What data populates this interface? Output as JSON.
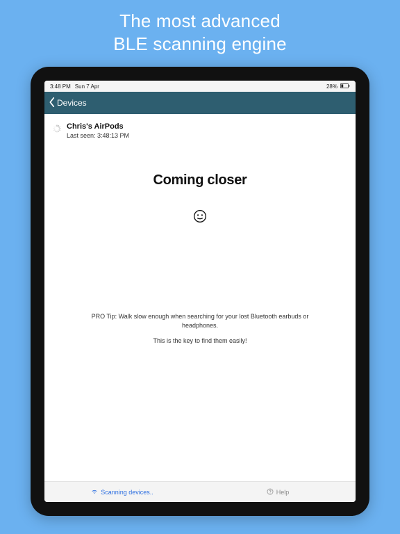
{
  "promo": {
    "line1": "The most advanced",
    "line2": "BLE scanning engine"
  },
  "status_bar": {
    "time": "3:48 PM",
    "date": "Sun 7 Apr",
    "battery": "28%"
  },
  "nav": {
    "back_label": "Devices"
  },
  "device": {
    "name": "Chris's AirPods",
    "last_seen_label": "Last seen: 3:48:13 PM"
  },
  "status_heading": "Coming closer",
  "tip": {
    "line1": "PRO Tip: Walk slow enough when searching for your lost Bluetooth earbuds or headphones.",
    "line2": "This is the key to find them easily!"
  },
  "toolbar": {
    "scan_label": "Scanning devices..",
    "help_label": "Help"
  }
}
